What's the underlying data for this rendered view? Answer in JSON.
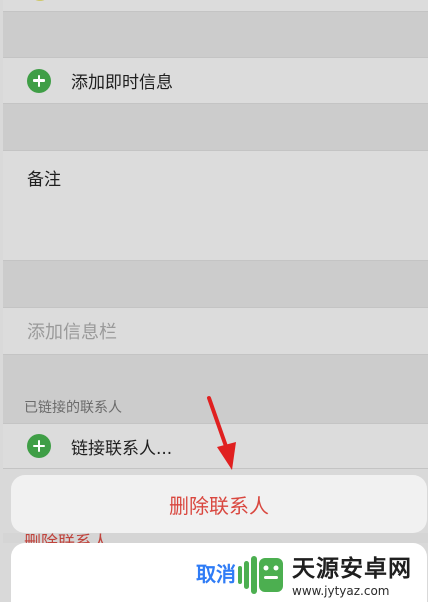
{
  "contact_form": {
    "add_im_label": "添加即时信息",
    "notes_label": "备注",
    "add_field_label": "添加信息栏",
    "linked_contacts_header": "已链接的联系人",
    "link_contact_label": "链接联系人...",
    "peek_delete_label": "删除联系人"
  },
  "action_sheet": {
    "delete_label": "删除联系人",
    "cancel_label": "取消"
  },
  "watermark": {
    "name": "天源安卓网",
    "url": "www.jytyaz.com"
  },
  "colors": {
    "plus_green": "#3f9e46",
    "delete_red": "#d9473f",
    "cancel_blue": "#2f7cf6",
    "arrow_red": "#e02020",
    "logo_green": "#4caf50"
  }
}
